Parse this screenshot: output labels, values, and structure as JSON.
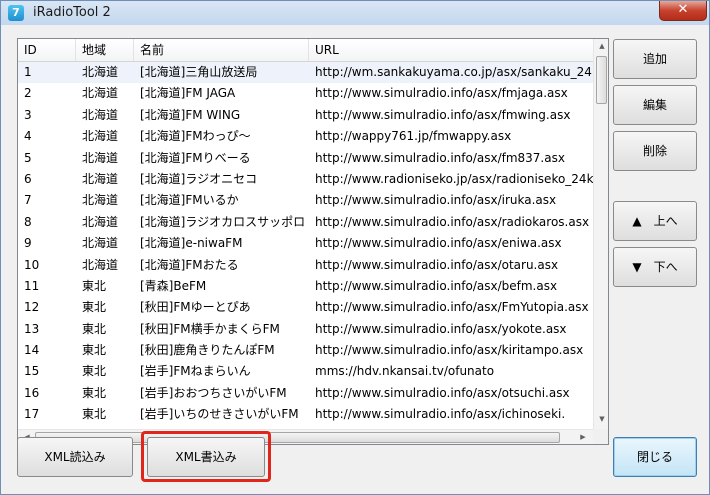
{
  "window": {
    "title": "iRadioTool 2",
    "app_icon": "7",
    "close_label": "✕"
  },
  "list": {
    "columns": [
      "ID",
      "地域",
      "名前",
      "URL"
    ],
    "rows": [
      [
        "1",
        "北海道",
        "[北海道]三角山放送局",
        "http://wm.sankakuyama.co.jp/asx/sankaku_24."
      ],
      [
        "2",
        "北海道",
        "[北海道]FM JAGA",
        "http://www.simulradio.info/asx/fmjaga.asx"
      ],
      [
        "3",
        "北海道",
        "[北海道]FM WING",
        "http://www.simulradio.info/asx/fmwing.asx"
      ],
      [
        "4",
        "北海道",
        "[北海道]FMわっぴ〜",
        "http://wappy761.jp/fmwappy.asx"
      ],
      [
        "5",
        "北海道",
        "[北海道]FMりべーる",
        "http://www.simulradio.info/asx/fm837.asx"
      ],
      [
        "6",
        "北海道",
        "[北海道]ラジオニセコ",
        "http://www.radioniseko.jp/asx/radioniseko_24k."
      ],
      [
        "7",
        "北海道",
        "[北海道]FMいるか",
        "http://www.simulradio.info/asx/iruka.asx"
      ],
      [
        "8",
        "北海道",
        "[北海道]ラジオカロスサッポロ",
        "http://www.simulradio.info/asx/radiokaros.asx"
      ],
      [
        "9",
        "北海道",
        "[北海道]e-niwaFM",
        "http://www.simulradio.info/asx/eniwa.asx"
      ],
      [
        "10",
        "北海道",
        "[北海道]FMおたる",
        "http://www.simulradio.info/asx/otaru.asx"
      ],
      [
        "11",
        "東北",
        "[青森]BeFM",
        "http://www.simulradio.info/asx/befm.asx"
      ],
      [
        "12",
        "東北",
        "[秋田]FMゆーとぴあ",
        "http://www.simulradio.info/asx/FmYutopia.asx"
      ],
      [
        "13",
        "東北",
        "[秋田]FM横手かまくらFM",
        "http://www.simulradio.info/asx/yokote.asx"
      ],
      [
        "14",
        "東北",
        "[秋田]鹿角きりたんぽFM",
        "http://www.simulradio.info/asx/kiritampo.asx"
      ],
      [
        "15",
        "東北",
        "[岩手]FMねまらいん",
        "mms://hdv.nkansai.tv/ofunato"
      ],
      [
        "16",
        "東北",
        "[岩手]おおつちさいがいFM",
        "http://www.simulradio.info/asx/otsuchi.asx"
      ],
      [
        "17",
        "東北",
        "[岩手]いちのせきさいがいFM",
        "http://www.simulradio.info/asx/ichinoseki."
      ]
    ]
  },
  "buttons": {
    "add": "追加",
    "edit": "編集",
    "delete": "削除",
    "up": "▲　上へ",
    "down": "▼　下へ",
    "xml_load": "XML読込み",
    "xml_save": "XML書込み",
    "close": "閉じる"
  },
  "colors": {
    "highlight": "#e0251b",
    "titlebar": "#c3d7ee"
  }
}
